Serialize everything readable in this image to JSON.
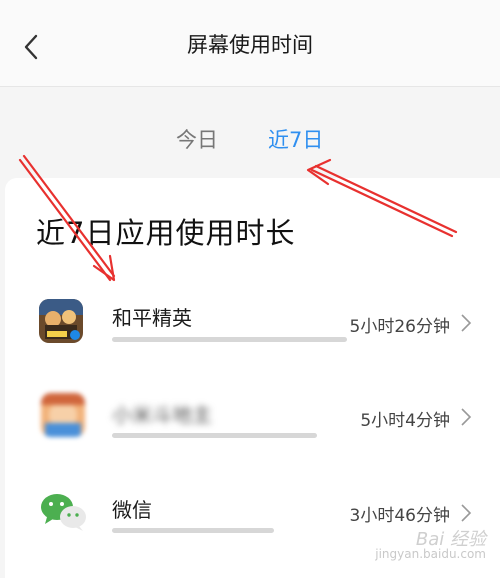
{
  "header": {
    "title": "屏幕使用时间",
    "back_icon": "chevron-left-icon"
  },
  "tabs": [
    {
      "label": "今日",
      "active": false
    },
    {
      "label": "近7日",
      "active": true
    }
  ],
  "section": {
    "title": "近7日应用使用时长"
  },
  "apps": [
    {
      "name": "和平精英",
      "duration": "5小时26分钟",
      "usage_fraction": 1.0,
      "icon": "game-app-icon",
      "name_blurred": false
    },
    {
      "name": "小米斗地主",
      "duration": "5小时4分钟",
      "usage_fraction": 0.93,
      "icon": "card-game-app-icon",
      "name_blurred": true
    },
    {
      "name": "微信",
      "duration": "3小时46分钟",
      "usage_fraction": 0.69,
      "icon": "wechat-icon",
      "name_blurred": false
    }
  ],
  "watermark": {
    "logo": "Bai 经验",
    "site": "jingyan.baidu.com"
  },
  "colors": {
    "accent": "#2f8ff0",
    "annotation": "#e8312f",
    "bar": "#d7d7d7"
  }
}
